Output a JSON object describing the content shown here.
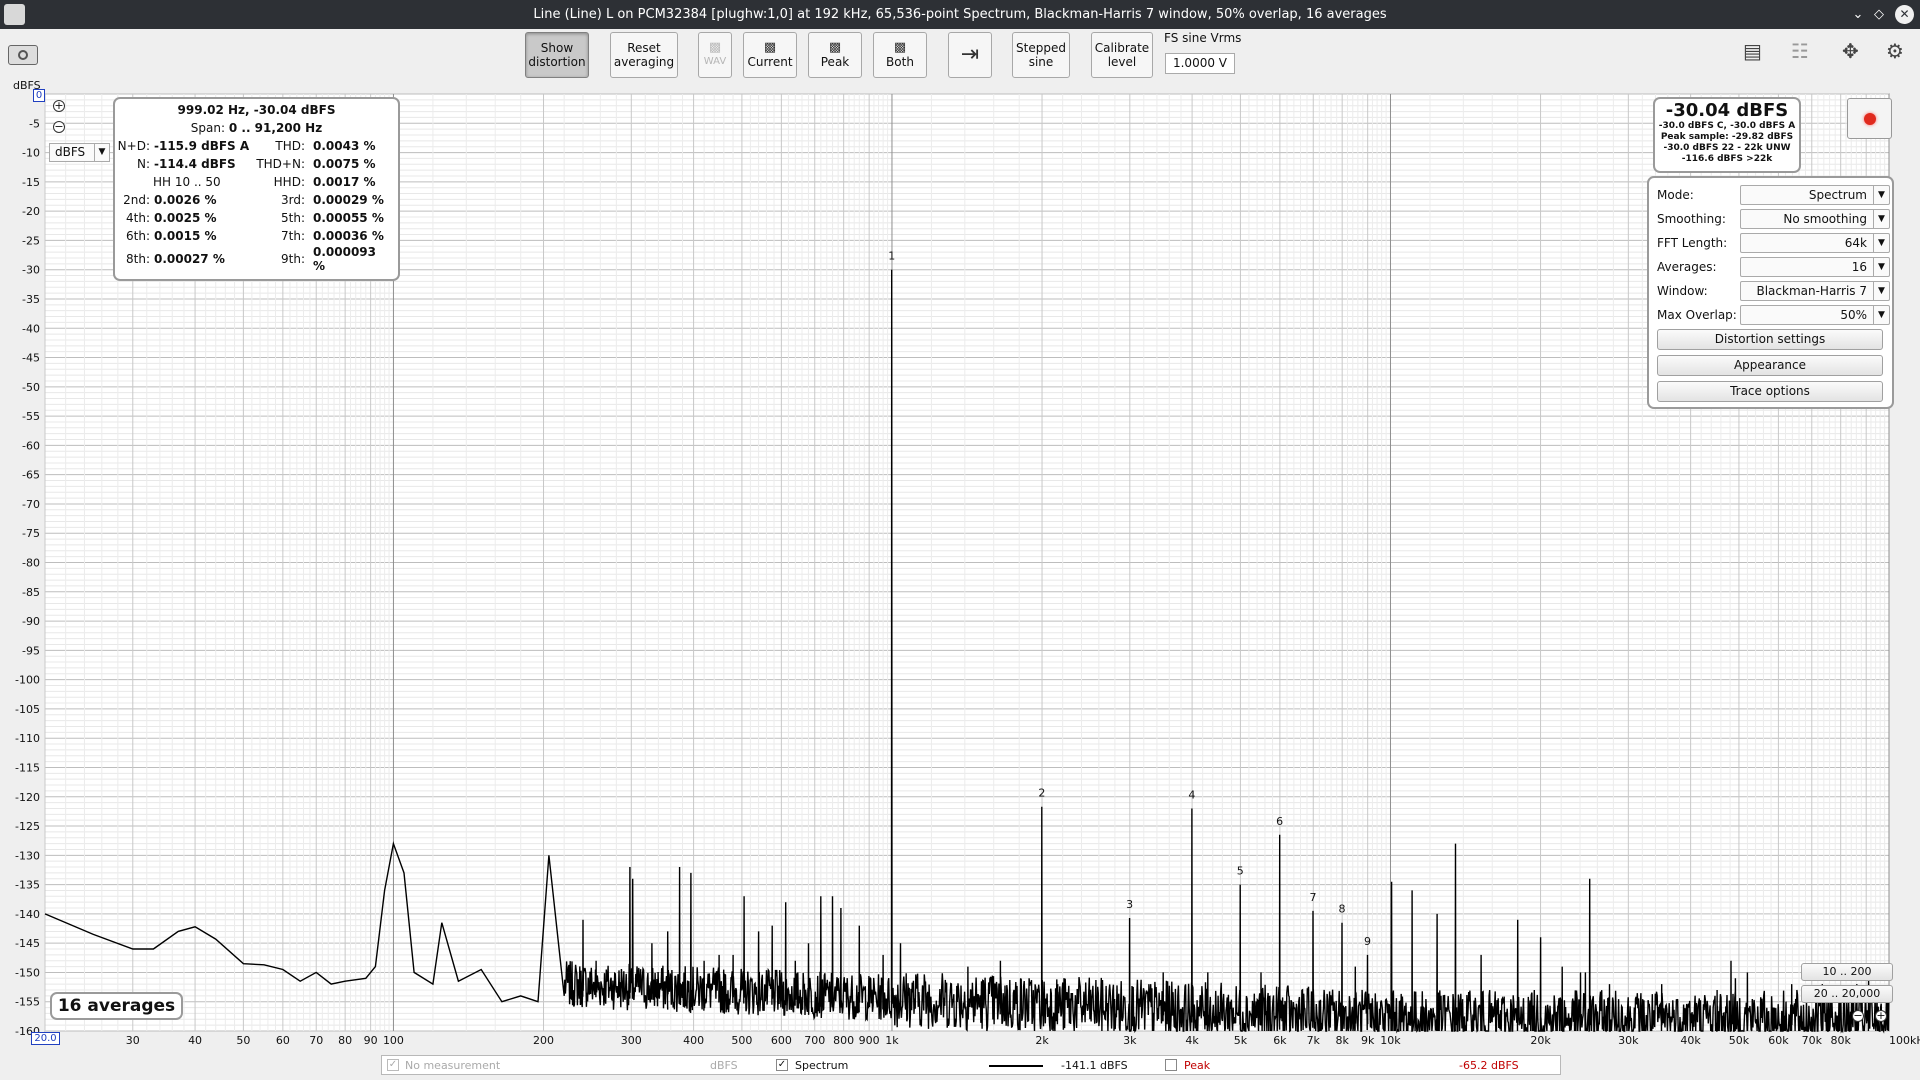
{
  "window": {
    "title": "Line (Line) L on PCM32384 [plughw:1,0] at 192 kHz, 65,536-point Spectrum, Blackman-Harris 7 window, 50% overlap, 16 averages",
    "controls": [
      "chevron-down",
      "restore",
      "close"
    ]
  },
  "toolbar": {
    "show_distortion": [
      "Show",
      "distortion"
    ],
    "reset_averaging": [
      "Reset",
      "averaging"
    ],
    "wav": "WAV",
    "current": "Current",
    "peak": "Peak",
    "both": "Both",
    "stepped_sine": [
      "Stepped",
      "sine"
    ],
    "calibrate_level": [
      "Calibrate",
      "level"
    ],
    "fs_label": "FS sine Vrms",
    "fs_value": "1.0000 V"
  },
  "distortion": {
    "header": "999.02 Hz, -30.04 dBFS",
    "span_label": "Span:",
    "span_value": "0 .. 91,200 Hz",
    "rows": [
      {
        "l1": "N+D:",
        "v1": "-115.9 dBFS A",
        "l2": "THD:",
        "v2": "0.0043 %"
      },
      {
        "l1": "N:",
        "v1": "-114.4 dBFS",
        "l2": "THD+N:",
        "v2": "0.0075 %"
      },
      {
        "l1": "",
        "v1": "HH 10 .. 50",
        "l2": "HHD:",
        "v2": "0.0017 %"
      },
      {
        "l1": "2nd:",
        "v1": "0.0026 %",
        "l2": "3rd:",
        "v2": "0.00029 %"
      },
      {
        "l1": "4th:",
        "v1": "0.0025 %",
        "l2": "5th:",
        "v2": "0.00055 %"
      },
      {
        "l1": "6th:",
        "v1": "0.0015 %",
        "l2": "7th:",
        "v2": "0.00036 %"
      },
      {
        "l1": "8th:",
        "v1": "0.00027 %",
        "l2": "9th:",
        "v2": "0.000093 %"
      }
    ]
  },
  "level": {
    "big": "-30.04 dBFS",
    "lines": [
      "-30.0 dBFS C, -30.0 dBFS A",
      "Peak sample: -29.82 dBFS",
      "-30.0 dBFS 22 - 22k UNW",
      "-116.6 dBFS >22k"
    ]
  },
  "controls": {
    "rows": [
      {
        "label": "Mode:",
        "value": "Spectrum"
      },
      {
        "label": "Smoothing:",
        "value": "No  smoothing"
      },
      {
        "label": "FFT Length:",
        "value": "64k"
      },
      {
        "label": "Averages:",
        "value": "16"
      },
      {
        "label": "Window:",
        "value": "Blackman-Harris 7"
      },
      {
        "label": "Max Overlap:",
        "value": "50%"
      }
    ],
    "buttons": [
      "Distortion settings",
      "Appearance",
      "Trace options"
    ]
  },
  "averages_label": "16 averages",
  "unit_select": "dBFS",
  "ylabel": "dBFS",
  "ytop_box": "0",
  "xstart_box": "20.0",
  "range_buttons": [
    "10 .. 200",
    "20 .. 20,000"
  ],
  "legend": {
    "no_measurement": "No measurement",
    "no_measurement_unit": "dBFS",
    "spectrum": "Spectrum",
    "spectrum_value": "-141.1 dBFS",
    "peak": "Peak",
    "peak_value": "-65.2 dBFS"
  },
  "colors": {
    "trace": "#000000",
    "peak": "#c00000",
    "grid": "#c8c8c8",
    "record": "#e02a1e"
  },
  "chart_data": {
    "type": "line",
    "title": "",
    "xlabel": "",
    "ylabel": "dBFS",
    "xscale": "log",
    "xlim": [
      20,
      100000
    ],
    "ylim": [
      -160,
      0
    ],
    "grid": true,
    "y_ticks": [
      -5,
      -10,
      -15,
      -20,
      -25,
      -30,
      -35,
      -40,
      -45,
      -50,
      -55,
      -60,
      -65,
      -70,
      -75,
      -80,
      -85,
      -90,
      -95,
      -100,
      -105,
      -110,
      -115,
      -120,
      -125,
      -130,
      -135,
      -140,
      -145,
      -150,
      -155,
      -160
    ],
    "x_tick_labels": [
      {
        "v": 30,
        "t": "30"
      },
      {
        "v": 40,
        "t": "40"
      },
      {
        "v": 50,
        "t": "50"
      },
      {
        "v": 60,
        "t": "60"
      },
      {
        "v": 70,
        "t": "70"
      },
      {
        "v": 80,
        "t": "80"
      },
      {
        "v": 90,
        "t": "90"
      },
      {
        "v": 100,
        "t": "100"
      },
      {
        "v": 200,
        "t": "200"
      },
      {
        "v": 300,
        "t": "300"
      },
      {
        "v": 400,
        "t": "400"
      },
      {
        "v": 500,
        "t": "500"
      },
      {
        "v": 600,
        "t": "600"
      },
      {
        "v": 700,
        "t": "700"
      },
      {
        "v": 800,
        "t": "800"
      },
      {
        "v": 900,
        "t": "900"
      },
      {
        "v": 1000,
        "t": "1k"
      },
      {
        "v": 2000,
        "t": "2k"
      },
      {
        "v": 3000,
        "t": "3k"
      },
      {
        "v": 4000,
        "t": "4k"
      },
      {
        "v": 5000,
        "t": "5k"
      },
      {
        "v": 6000,
        "t": "6k"
      },
      {
        "v": 7000,
        "t": "7k"
      },
      {
        "v": 8000,
        "t": "8k"
      },
      {
        "v": 9000,
        "t": "9k"
      },
      {
        "v": 10000,
        "t": "10k"
      },
      {
        "v": 20000,
        "t": "20k"
      },
      {
        "v": 30000,
        "t": "30k"
      },
      {
        "v": 40000,
        "t": "40k"
      },
      {
        "v": 50000,
        "t": "50k"
      },
      {
        "v": 60000,
        "t": "60k"
      },
      {
        "v": 70000,
        "t": "70k"
      },
      {
        "v": 80000,
        "t": "80k"
      },
      {
        "v": 100000,
        "t": "100kHz"
      }
    ],
    "harmonics": [
      {
        "n": "1",
        "f": 999,
        "db": -30.0
      },
      {
        "n": "2",
        "f": 1998,
        "db": -121.7
      },
      {
        "n": "3",
        "f": 2997,
        "db": -140.7
      },
      {
        "n": "4",
        "f": 3996,
        "db": -122.0
      },
      {
        "n": "5",
        "f": 4995,
        "db": -135.0
      },
      {
        "n": "6",
        "f": 5994,
        "db": -126.5
      },
      {
        "n": "7",
        "f": 6993,
        "db": -139.5
      },
      {
        "n": "8",
        "f": 7992,
        "db": -141.5
      },
      {
        "n": "9",
        "f": 8991,
        "db": -147.0
      }
    ],
    "series": [
      {
        "name": "Spectrum",
        "low_freq_curve": [
          [
            20,
            -140
          ],
          [
            25,
            -143.5
          ],
          [
            30,
            -146
          ],
          [
            33,
            -146
          ],
          [
            37,
            -143
          ],
          [
            40,
            -142.2
          ],
          [
            44,
            -144.3
          ],
          [
            50,
            -148.5
          ],
          [
            55,
            -148.7
          ],
          [
            60,
            -149.5
          ],
          [
            65,
            -151.5
          ],
          [
            70,
            -150
          ],
          [
            75,
            -152
          ],
          [
            80,
            -151.5
          ],
          [
            88,
            -151
          ],
          [
            92,
            -149
          ],
          [
            96,
            -136
          ],
          [
            100,
            -128
          ],
          [
            105,
            -133
          ],
          [
            110,
            -150
          ],
          [
            120,
            -152
          ],
          [
            125,
            -141.5
          ],
          [
            135,
            -151.5
          ],
          [
            150,
            -149.5
          ],
          [
            165,
            -155
          ],
          [
            180,
            -154
          ],
          [
            195,
            -155
          ],
          [
            205,
            -130
          ],
          [
            220,
            -154
          ]
        ],
        "spurs": [
          [
            240,
            -141
          ],
          [
            255,
            -148
          ],
          [
            298,
            -132
          ],
          [
            302,
            -134
          ],
          [
            330,
            -145
          ],
          [
            355,
            -143
          ],
          [
            375,
            -132
          ],
          [
            395,
            -133
          ],
          [
            420,
            -148
          ],
          [
            450,
            -147
          ],
          [
            480,
            -147
          ],
          [
            505,
            -137
          ],
          [
            540,
            -143
          ],
          [
            575,
            -142
          ],
          [
            612,
            -138
          ],
          [
            640,
            -148
          ],
          [
            680,
            -145
          ],
          [
            720,
            -137
          ],
          [
            760,
            -137
          ],
          [
            790,
            -139
          ],
          [
            860,
            -142
          ],
          [
            960,
            -147
          ],
          [
            1040,
            -145
          ],
          [
            1420,
            -149
          ],
          [
            1650,
            -148
          ],
          [
            2150,
            -152
          ],
          [
            3500,
            -150
          ],
          [
            4300,
            -150
          ],
          [
            5500,
            -150
          ],
          [
            8500,
            -149
          ],
          [
            10050,
            -134.5
          ],
          [
            11050,
            -136
          ],
          [
            12400,
            -140
          ],
          [
            13500,
            -128
          ],
          [
            15200,
            -147
          ],
          [
            18000,
            -141
          ],
          [
            20000,
            -144
          ],
          [
            22100,
            -149
          ],
          [
            24050,
            -150
          ],
          [
            24600,
            -150
          ],
          [
            25100,
            -134
          ],
          [
            27500,
            -152
          ],
          [
            35000,
            -152
          ],
          [
            45200,
            -153
          ],
          [
            48200,
            -148
          ],
          [
            49200,
            -151
          ],
          [
            52000,
            -150
          ],
          [
            63800,
            -152
          ],
          [
            73500,
            -152
          ],
          [
            86200,
            -152
          ],
          [
            91000,
            -150
          ]
        ],
        "floor_start_hz": 220,
        "floor_db_low": -152,
        "floor_db_high": -158
      }
    ]
  }
}
